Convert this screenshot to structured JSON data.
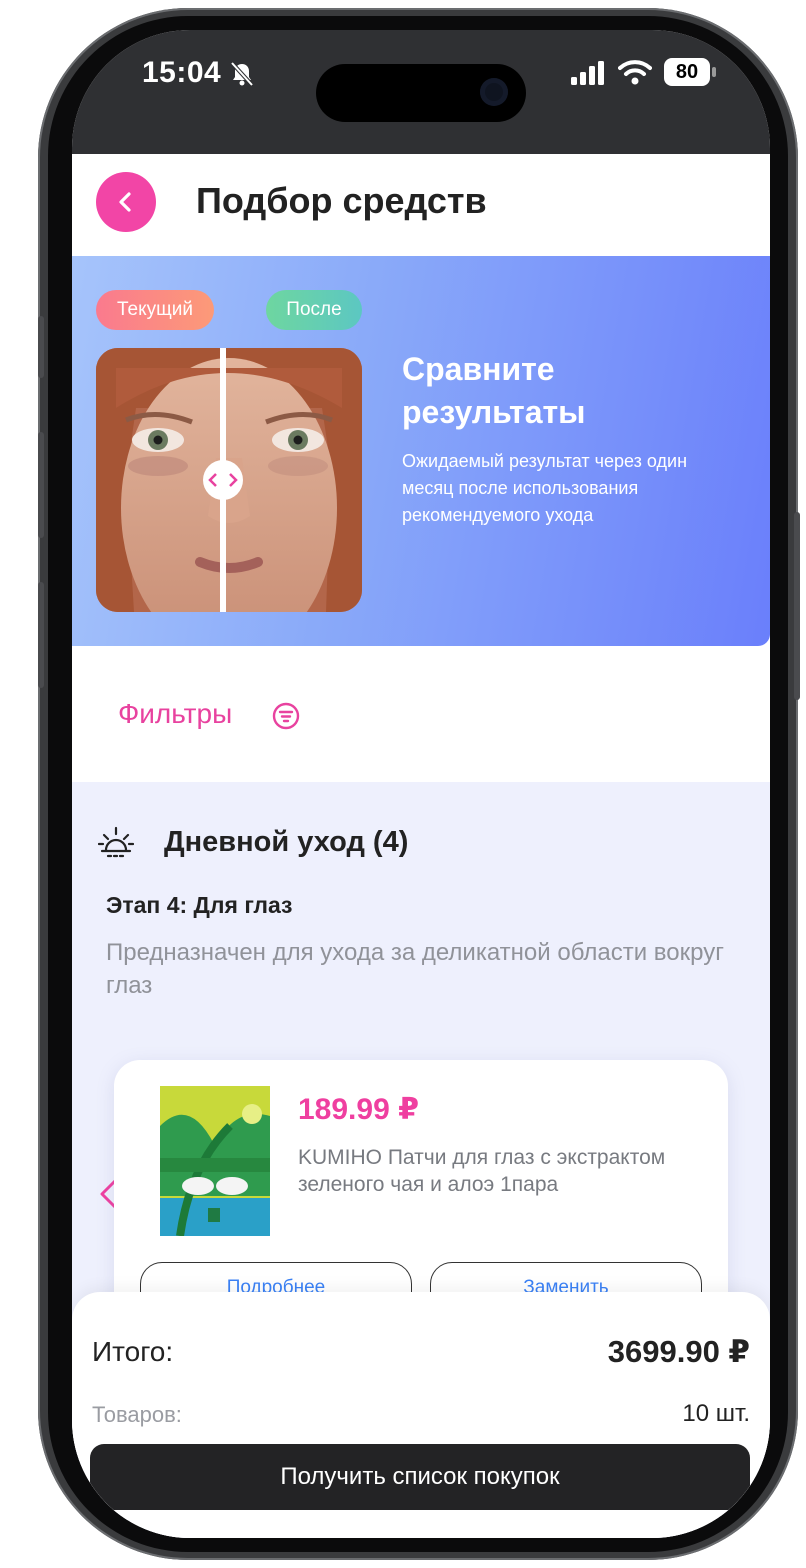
{
  "status_bar": {
    "time": "15:04",
    "battery": "80",
    "icons": [
      "bell-off-icon",
      "signal-icon",
      "wifi-icon",
      "battery-icon"
    ]
  },
  "header": {
    "back_icon": "chevron-left-icon",
    "title": "Подбор средств"
  },
  "compare": {
    "tag_current": "Текущий",
    "tag_after": "После",
    "title": "Сравните результаты",
    "description": "Ожидаемый результат через один месяц после использования рекомендуемого ухода"
  },
  "filters": {
    "label": "Фильтры",
    "icon": "filter-icon"
  },
  "routine": {
    "icon": "sunrise-icon",
    "title": "Дневной уход (4)",
    "stage_title": "Этап 4: Для глаз",
    "stage_description": "Предназначен для ухода за деликатной области вокруг глаз",
    "product": {
      "price": "189.99 ₽",
      "name": "KUMIHO Патчи для глаз с экстрактом зеленого чая и алоэ 1пара",
      "more_label": "Подробнее",
      "replace_label": "Заменить"
    }
  },
  "summary": {
    "total_label": "Итого:",
    "total_value": "3699.90 ₽",
    "count_label": "Товаров:",
    "count_value": "10 шт.",
    "cta_label": "Получить список покупок"
  },
  "colors": {
    "accent_pink": "#f245a6",
    "banner_gradient_start": "#a6c4fb",
    "banner_gradient_end": "#6a7ffb",
    "section_bg": "#eef0fd",
    "cta_bg": "#232325"
  }
}
